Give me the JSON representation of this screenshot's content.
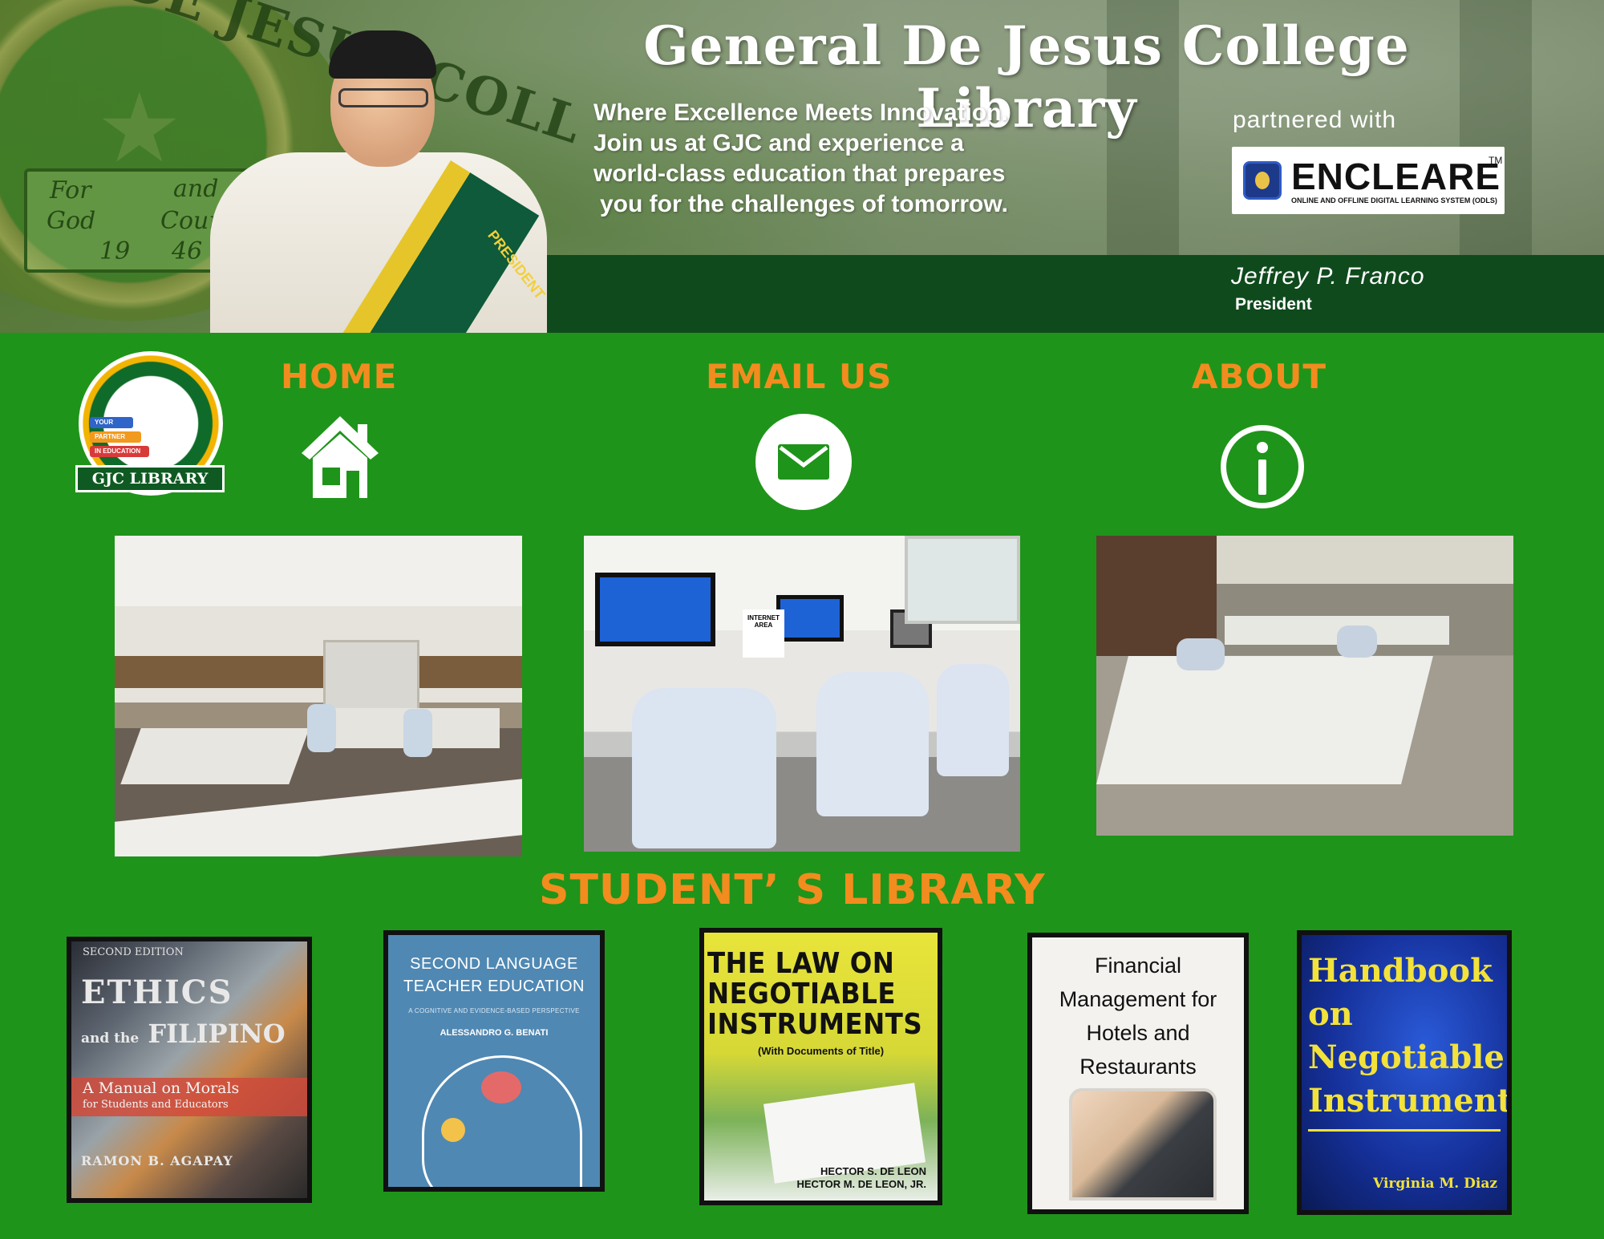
{
  "header": {
    "title": "General De Jesus College Library",
    "tagline": [
      "Where Excellence Meets Innovation.",
      "Join us at GJC and experience a",
      "world-class education that prepares",
      "you for the challenges of tomorrow."
    ],
    "partner_label": "partnered with",
    "partner_name": "ENCLEARE",
    "partner_tm": "TM",
    "partner_subtitle": "ONLINE AND OFFLINE DIGITAL LEARNING SYSTEM (ODLS)",
    "president_name": "Jeffrey P. Franco",
    "president_role": "President",
    "seal_text": "AL DE JESUS COLL",
    "seal_motto": [
      "For",
      "and",
      "God",
      "Country",
      "19",
      "46"
    ],
    "sash_label": "PRESIDENT"
  },
  "logo": {
    "label": "GJC LIBRARY",
    "tags": [
      "YOUR",
      "PARTNER",
      "IN EDUCATION"
    ]
  },
  "nav": {
    "home": "HOME",
    "email": "EMAIL US",
    "about": "ABOUT"
  },
  "photo_signs": {
    "internet_area": "INTERNET AREA"
  },
  "library": {
    "title": "STUDENT’ S LIBRARY",
    "books": [
      {
        "edition": "SECOND EDITION",
        "title": "ETHICS",
        "subtitle_small": "and the",
        "subtitle": "FILIPINO",
        "tagline": "A Manual on Morals",
        "tagline2": "for Students and Educators",
        "author": "RAMON B. AGAPAY"
      },
      {
        "title_line1": "SECOND LANGUAGE",
        "title_line2": "TEACHER EDUCATION",
        "subtitle": "A COGNITIVE AND EVIDENCE-BASED PERSPECTIVE",
        "author": "ALESSANDRO G. BENATI"
      },
      {
        "title_line1": "THE LAW ON",
        "title_line2": "NEGOTIABLE",
        "title_line3": "INSTRUMENTS",
        "subtitle": "(With Documents of Title)",
        "author1": "HECTOR S. DE LEON",
        "author2": "HECTOR M. DE LEON, JR."
      },
      {
        "title_line1": "Financial",
        "title_line2": "Management for",
        "title_line3": "Hotels and",
        "title_line4": "Restaurants"
      },
      {
        "title_line1": "Handbook",
        "title_line2": "on",
        "title_line3": "Negotiable",
        "title_line4": "Instruments",
        "author": "Virginia M. Diaz"
      }
    ]
  },
  "colors": {
    "background": "#1f941a",
    "accent_orange": "#f28c1e",
    "banner_dark_green": "#0f4a1d"
  }
}
